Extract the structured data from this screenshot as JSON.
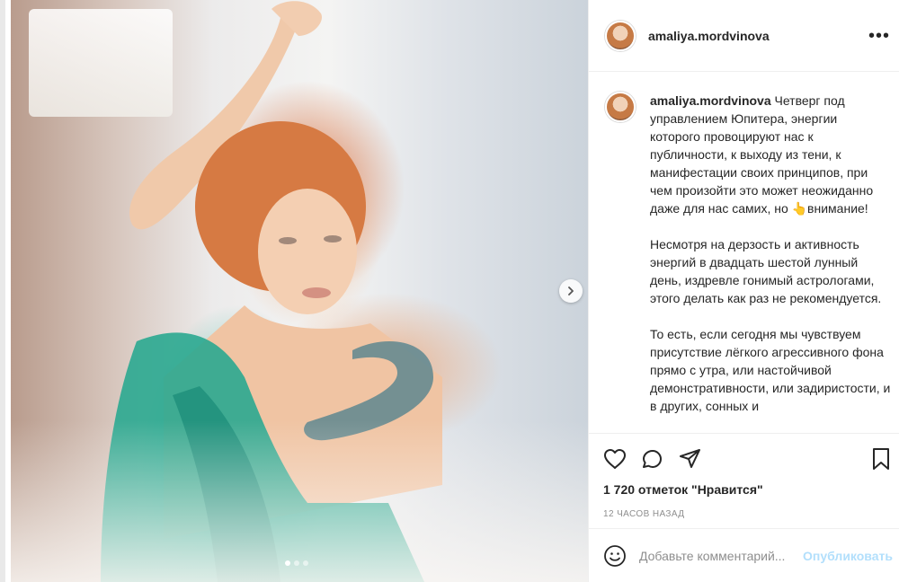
{
  "post": {
    "username": "amaliya.mordvinova",
    "more_label": "•••",
    "caption_paragraphs": [
      "Четверг под управлением Юпитера, энергии которого провоцируют нас к публичности, к выходу из тени, к манифестации своих принципов, при чем произойти это может неожиданно даже для нас самих, но 👆внимание!",
      "Несмотря на дерзость и активность энергий в двадцать шестой лунный день, издревле гонимый астрологами, этого делать как раз не рекомендуется.",
      "То есть, если сегодня мы чувствуем присутствие лёгкого агрессивного фона прямо с утра, или настойчивой демонстративности, или задиристости, и в других, сонных и"
    ],
    "likes": "1 720 отметок \"Нравится\"",
    "time_ago": "12 ЧАСОВ НАЗАД",
    "carousel": {
      "current": 1,
      "total": 3
    }
  },
  "comment": {
    "placeholder": "Добавьте комментарий...",
    "publish_label": "Опубликовать"
  },
  "icons": {
    "like": "heart-icon",
    "comment": "comment-icon",
    "share": "paper-plane-icon",
    "save": "bookmark-icon",
    "emoji": "smiley-icon",
    "next": "chevron-right-icon"
  },
  "colors": {
    "text": "#262626",
    "muted": "#8e8e8e",
    "publish_disabled": "#b2dffc",
    "border": "#efefef"
  }
}
